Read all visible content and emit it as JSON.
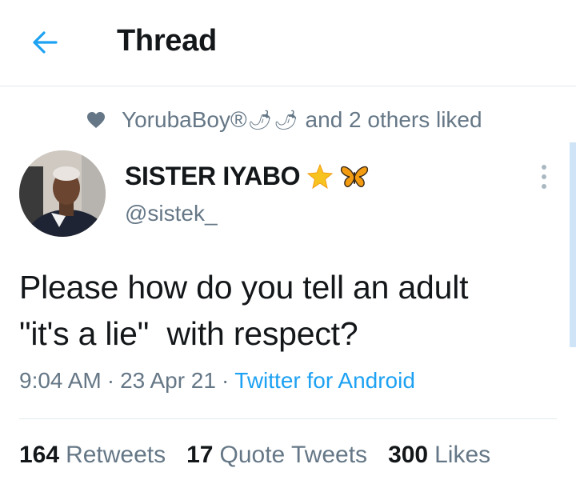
{
  "header": {
    "title": "Thread",
    "back_icon": "arrow-left-icon"
  },
  "social_context": {
    "user": "YorubaBoy®",
    "emojis": [
      "🌶",
      "🌶"
    ],
    "suffix": "and 2 others liked",
    "icon": "heart-icon"
  },
  "tweet": {
    "author_name": "SISTER IYABO",
    "author_emojis": [
      "🌟",
      "🦋"
    ],
    "handle": "@sistek_",
    "text": "Please how do you tell an adult\n\"it's a lie\"  with respect?",
    "time": "9:04 AM",
    "date": "23 Apr 21",
    "separator": "·",
    "source": "Twitter for Android"
  },
  "stats": [
    {
      "count": "164",
      "label": "Retweets"
    },
    {
      "count": "17",
      "label": "Quote Tweets"
    },
    {
      "count": "300",
      "label": "Likes"
    }
  ],
  "colors": {
    "accent": "#1da1f2",
    "secondary_text": "#657786",
    "primary_text": "#14171a",
    "divider": "#e1e8ed"
  }
}
